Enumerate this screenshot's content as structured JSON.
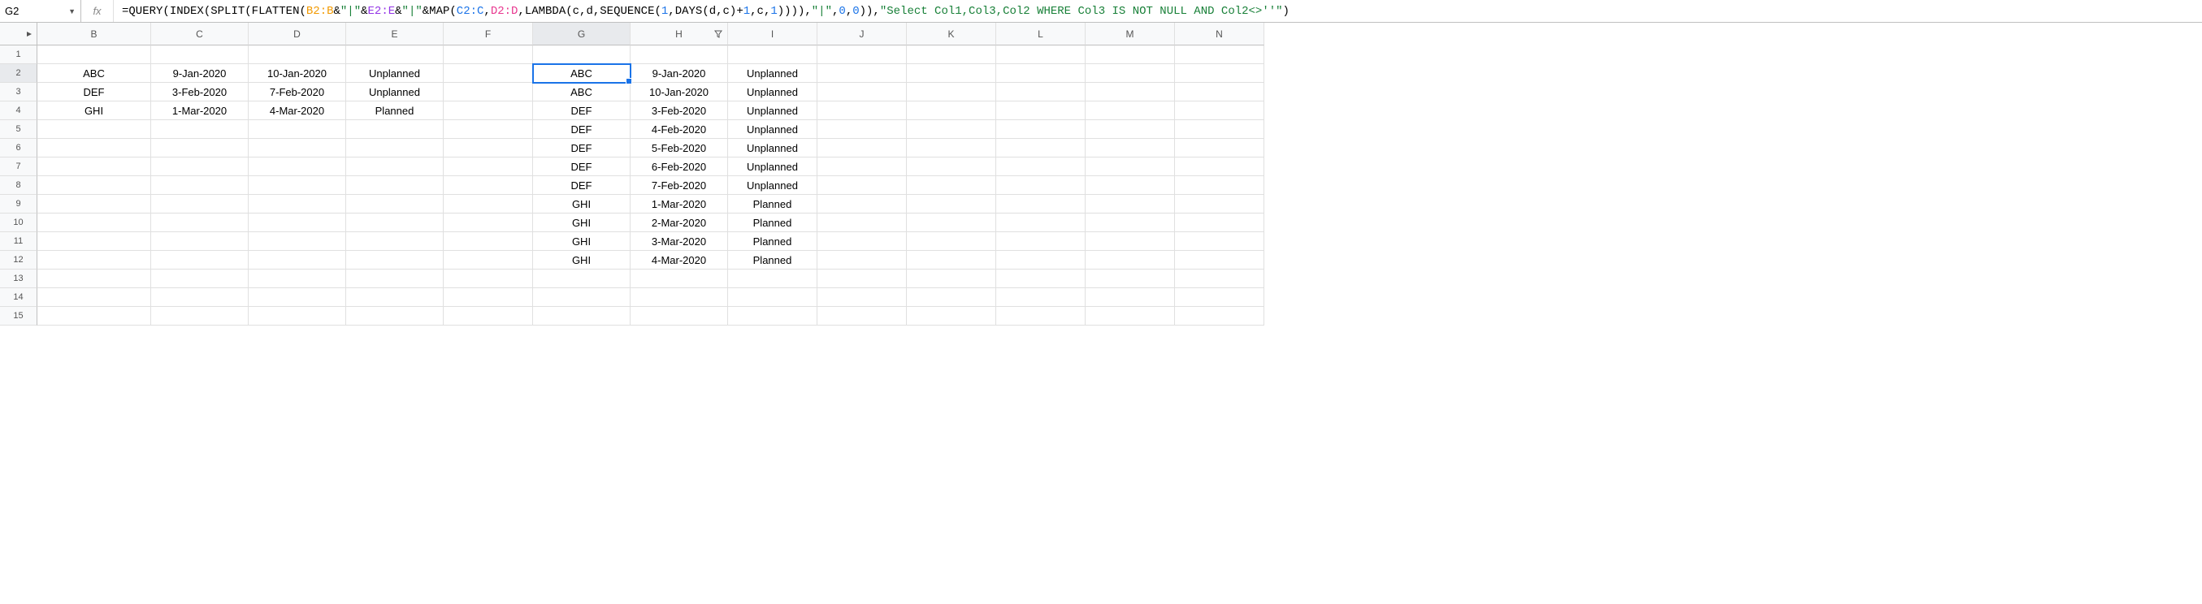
{
  "cellRef": "G2",
  "formula": {
    "parts": [
      {
        "cls": "f-black",
        "t": "="
      },
      {
        "cls": "f-black",
        "t": "QUERY"
      },
      {
        "cls": "f-black",
        "t": "("
      },
      {
        "cls": "f-black",
        "t": "INDEX"
      },
      {
        "cls": "f-black",
        "t": "("
      },
      {
        "cls": "f-black",
        "t": "SPLIT"
      },
      {
        "cls": "f-black",
        "t": "("
      },
      {
        "cls": "f-black",
        "t": "FLATTEN"
      },
      {
        "cls": "f-black",
        "t": "("
      },
      {
        "cls": "f-orange",
        "t": "B2:B"
      },
      {
        "cls": "f-black",
        "t": "&"
      },
      {
        "cls": "f-green",
        "t": "\"|\""
      },
      {
        "cls": "f-black",
        "t": "&"
      },
      {
        "cls": "f-purple",
        "t": "E2:E"
      },
      {
        "cls": "f-black",
        "t": "&"
      },
      {
        "cls": "f-green",
        "t": "\"|\""
      },
      {
        "cls": "f-black",
        "t": "&"
      },
      {
        "cls": "f-black",
        "t": "MAP"
      },
      {
        "cls": "f-black",
        "t": "("
      },
      {
        "cls": "f-blue",
        "t": "C2:C"
      },
      {
        "cls": "f-black",
        "t": ","
      },
      {
        "cls": "f-magenta",
        "t": "D2:D"
      },
      {
        "cls": "f-black",
        "t": ","
      },
      {
        "cls": "f-black",
        "t": "LAMBDA"
      },
      {
        "cls": "f-black",
        "t": "(c,d,"
      },
      {
        "cls": "f-black",
        "t": "SEQUENCE"
      },
      {
        "cls": "f-black",
        "t": "("
      },
      {
        "cls": "f-blue",
        "t": "1"
      },
      {
        "cls": "f-black",
        "t": ","
      },
      {
        "cls": "f-black",
        "t": "DAYS"
      },
      {
        "cls": "f-black",
        "t": "(d,c)+"
      },
      {
        "cls": "f-blue",
        "t": "1"
      },
      {
        "cls": "f-black",
        "t": ",c,"
      },
      {
        "cls": "f-blue",
        "t": "1"
      },
      {
        "cls": "f-black",
        "t": ")))),"
      },
      {
        "cls": "f-green",
        "t": "\"|\""
      },
      {
        "cls": "f-black",
        "t": ","
      },
      {
        "cls": "f-blue",
        "t": "0"
      },
      {
        "cls": "f-black",
        "t": ","
      },
      {
        "cls": "f-blue",
        "t": "0"
      },
      {
        "cls": "f-black",
        "t": ")),"
      },
      {
        "cls": "f-green",
        "t": "\"Select Col1,Col3,Col2 WHERE Col3 IS NOT NULL AND Col2<>''\""
      },
      {
        "cls": "f-black",
        "t": ")"
      }
    ]
  },
  "columns": [
    "B",
    "C",
    "D",
    "E",
    "F",
    "G",
    "H",
    "I",
    "J",
    "K",
    "L",
    "M",
    "N"
  ],
  "selectedCol": "G",
  "selectedRow": 2,
  "filterCol": "H",
  "rowCount": 15,
  "data": {
    "1": {},
    "2": {
      "B": "ABC",
      "C": "9-Jan-2020",
      "D": "10-Jan-2020",
      "E": "Unplanned",
      "G": "ABC",
      "H": "9-Jan-2020",
      "I": "Unplanned"
    },
    "3": {
      "B": "DEF",
      "C": "3-Feb-2020",
      "D": "7-Feb-2020",
      "E": "Unplanned",
      "G": "ABC",
      "H": "10-Jan-2020",
      "I": "Unplanned"
    },
    "4": {
      "B": "GHI",
      "C": "1-Mar-2020",
      "D": "4-Mar-2020",
      "E": "Planned",
      "G": "DEF",
      "H": "3-Feb-2020",
      "I": "Unplanned"
    },
    "5": {
      "G": "DEF",
      "H": "4-Feb-2020",
      "I": "Unplanned"
    },
    "6": {
      "G": "DEF",
      "H": "5-Feb-2020",
      "I": "Unplanned"
    },
    "7": {
      "G": "DEF",
      "H": "6-Feb-2020",
      "I": "Unplanned"
    },
    "8": {
      "G": "DEF",
      "H": "7-Feb-2020",
      "I": "Unplanned"
    },
    "9": {
      "G": "GHI",
      "H": "1-Mar-2020",
      "I": "Planned"
    },
    "10": {
      "G": "GHI",
      "H": "2-Mar-2020",
      "I": "Planned"
    },
    "11": {
      "G": "GHI",
      "H": "3-Mar-2020",
      "I": "Planned"
    },
    "12": {
      "G": "GHI",
      "H": "4-Mar-2020",
      "I": "Planned"
    }
  }
}
